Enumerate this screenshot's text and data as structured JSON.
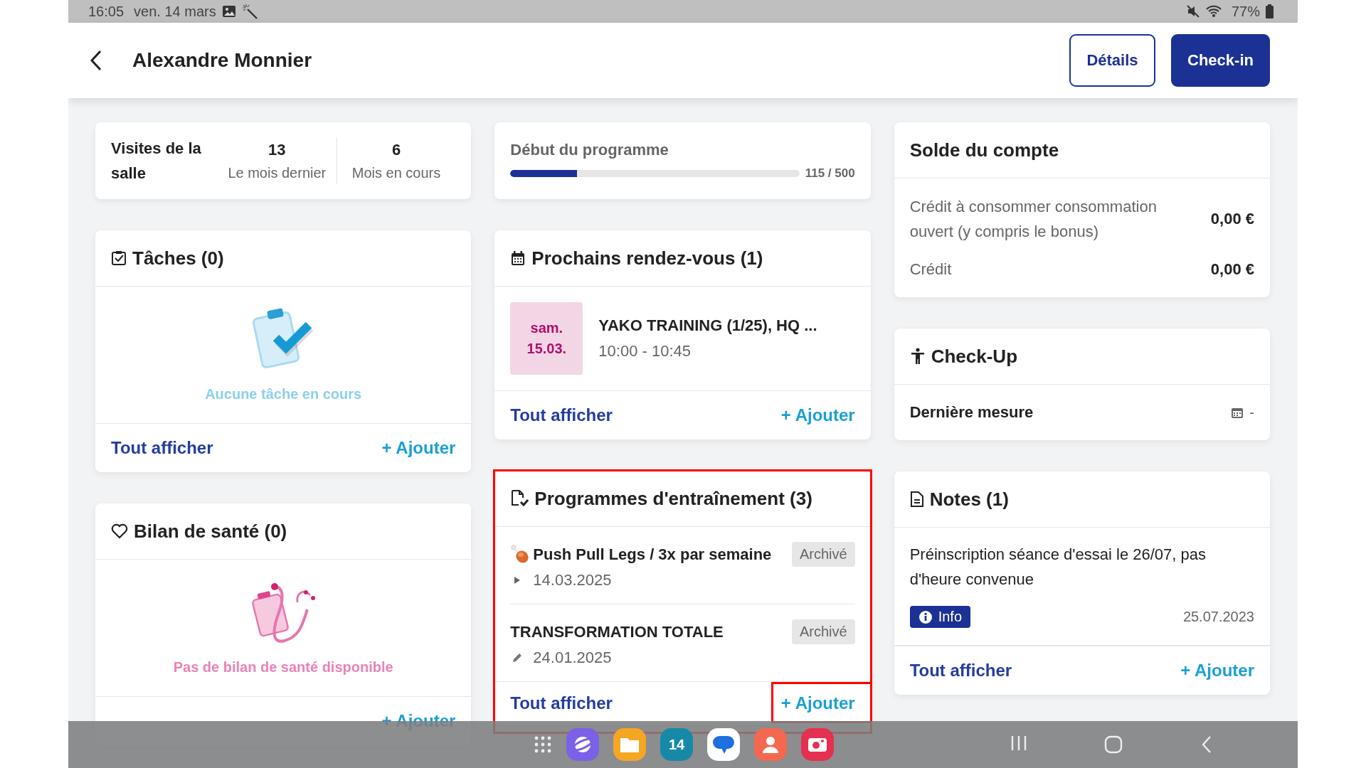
{
  "status_bar": {
    "time": "16:05",
    "date": "ven. 14 mars",
    "battery": "77%"
  },
  "header": {
    "title": "Alexandre Monnier",
    "buttons": [
      {
        "label": "Détails",
        "kind": "outline"
      },
      {
        "label": "Check-in",
        "kind": "filled"
      }
    ]
  },
  "visits": {
    "title": "Visites de la salle",
    "stats": [
      {
        "value": "13",
        "label": "Le mois dernier"
      },
      {
        "value": "6",
        "label": "Mois en cours"
      }
    ]
  },
  "program_start": {
    "title": "Début du programme",
    "level": 0.23,
    "reading": "115 / 500"
  },
  "balance": {
    "title": "Solde du compte",
    "rows": [
      {
        "label": "Crédit à consommer consommation ouvert (y compris le bonus)",
        "value": "0,00 €"
      },
      {
        "label": "Crédit",
        "value": "0,00 €"
      }
    ]
  },
  "tasks": {
    "title": "Tâches (0)",
    "empty_text": "Aucune tâche en cours",
    "footer": {
      "view_all": "Tout afficher",
      "add": "+ Ajouter"
    }
  },
  "appointments": {
    "title": "Prochains rendez-vous (1)",
    "items": [
      {
        "day": "sam.",
        "date": "15.03.",
        "title": "YAKO TRAINING (1/25), HQ ...",
        "time": "10:00 - 10:45"
      }
    ],
    "footer": {
      "view_all": "Tout afficher",
      "add": "+ Ajouter"
    }
  },
  "checkup": {
    "title": "Check-Up",
    "label": "Dernière mesure",
    "value": "-"
  },
  "health": {
    "title": "Bilan de santé (0)",
    "empty_text": "Pas de bilan de santé disponible",
    "footer": {
      "add": "+ Ajouter"
    }
  },
  "programs": {
    "title": "Programmes d'entraînement (3)",
    "highlighted": true,
    "add_highlighted": true,
    "items": [
      {
        "name": "Push Pull Legs / 3x par semaine",
        "food_icon": true,
        "badge": "Archivé",
        "kind": "play",
        "date": "14.03.2025"
      },
      {
        "name": "TRANSFORMATION TOTALE",
        "badge": "Archivé",
        "kind": "edit",
        "date": "24.01.2025"
      }
    ],
    "footer": {
      "view_all": "Tout afficher",
      "add": "+ Ajouter"
    }
  },
  "notes": {
    "title": "Notes (1)",
    "items": [
      {
        "text": "Préinscription séance d'essai le 26/07, pas d'heure convenue",
        "tag": "Info",
        "date": "25.07.2023"
      }
    ],
    "footer": {
      "view_all": "Tout afficher",
      "add": "+ Ajouter"
    }
  },
  "nav_bar": {
    "apps": [
      {
        "kind": "browser"
      },
      {
        "kind": "folder"
      },
      {
        "kind": "calendar",
        "label": "14"
      },
      {
        "kind": "chat"
      },
      {
        "kind": "contact"
      },
      {
        "kind": "camera"
      }
    ]
  }
}
